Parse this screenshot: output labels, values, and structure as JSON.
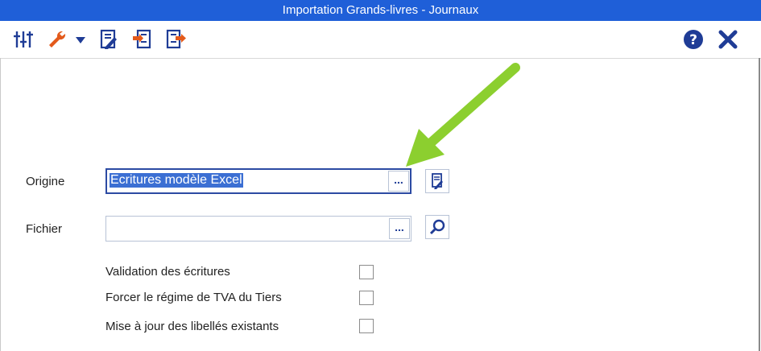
{
  "window": {
    "title": "Importation Grands-livres - Journaux"
  },
  "toolbar": {
    "icons": [
      "sliders-icon",
      "wrench-icon",
      "dropdown-arrow-icon",
      "document-pen-icon",
      "import-document-icon",
      "export-document-icon"
    ],
    "right_icons": [
      "help-icon",
      "close-icon"
    ]
  },
  "form": {
    "origine": {
      "label": "Origine",
      "value": "Ecritures modèle Excel",
      "button": "..."
    },
    "fichier": {
      "label": "Fichier",
      "value": "",
      "button": "..."
    },
    "options": [
      {
        "label": "Validation des écritures",
        "checked": false
      },
      {
        "label": "Forcer le régime de TVA du Tiers",
        "checked": false
      },
      {
        "label": "Mise à jour des libellés existants",
        "checked": false
      }
    ]
  },
  "colors": {
    "titlebar": "#1f5fd8",
    "accent_icon": "#1f3c96",
    "wrench": "#e35a1b",
    "arrow": "#8ccf2f"
  }
}
